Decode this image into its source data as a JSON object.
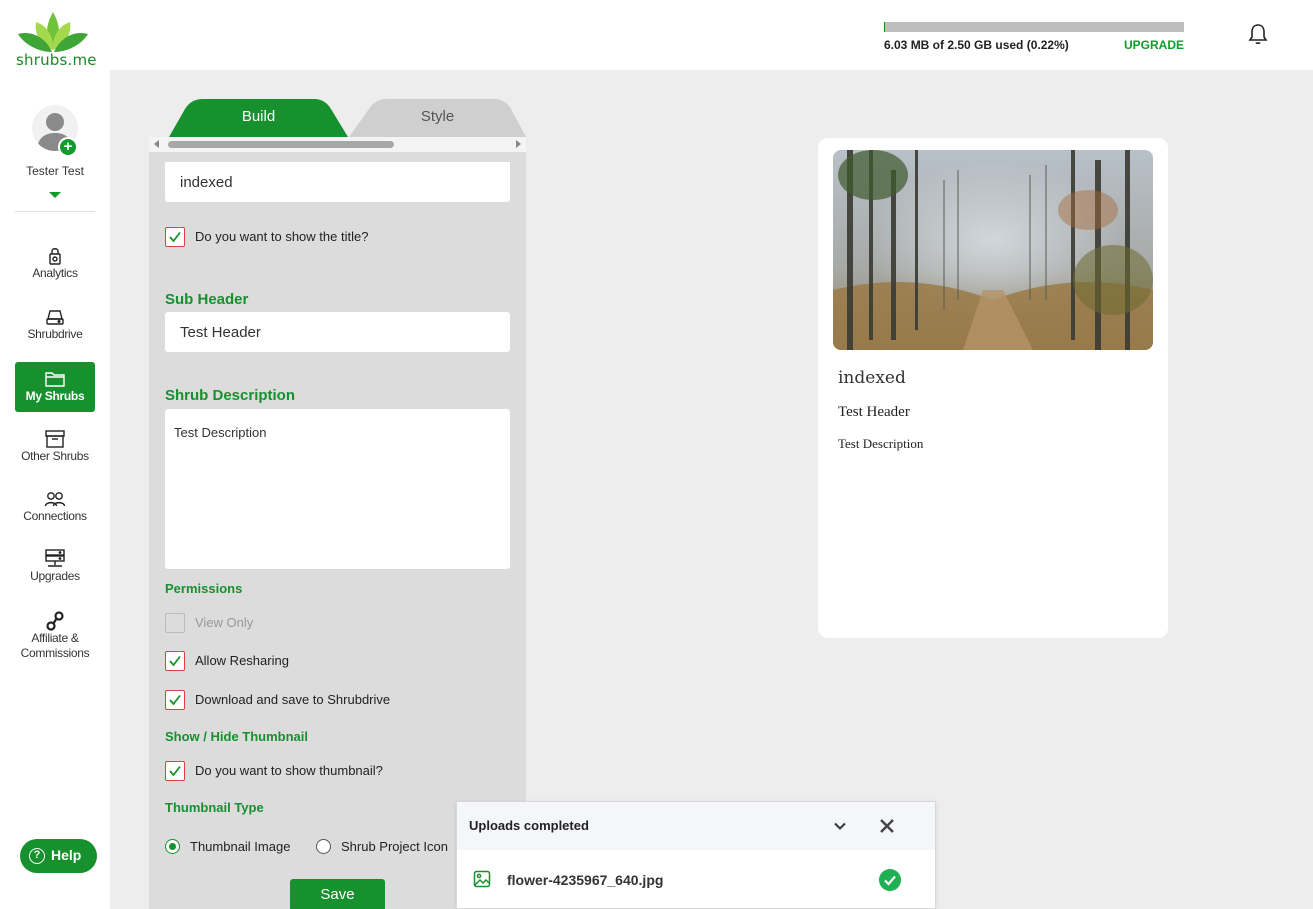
{
  "brand": {
    "name": "shrubs.me"
  },
  "storage": {
    "used_text": "6.03 MB of 2.50 GB used (0.22%)",
    "used_fraction": 0.0022,
    "upgrade_label": "UPGRADE"
  },
  "user": {
    "name": "Tester Test"
  },
  "sidebar": {
    "items": [
      {
        "label": "Analytics",
        "icon": "analytics-lock-icon"
      },
      {
        "label": "Shrubdrive",
        "icon": "drive-icon"
      },
      {
        "label": "My Shrubs",
        "icon": "folder-icon",
        "active": true
      },
      {
        "label": "Other Shrubs",
        "icon": "archive-box-icon"
      },
      {
        "label": "Connections",
        "icon": "people-icon"
      },
      {
        "label": "Upgrades",
        "icon": "server-icon"
      },
      {
        "label": "Affiliate &",
        "label2": "Commissions",
        "icon": "link-icon"
      }
    ],
    "help_label": "Help"
  },
  "editor": {
    "tabs": [
      {
        "label": "Build",
        "active": true
      },
      {
        "label": "Style",
        "active": false
      }
    ],
    "title_value": "indexed",
    "show_title_label": "Do you want to show the title?",
    "show_title_checked": true,
    "sub_header_label": "Sub Header",
    "sub_header_value": "Test Header",
    "description_label": "Shrub Description",
    "description_value": "Test Description",
    "permissions_label": "Permissions",
    "permissions": [
      {
        "label": "View Only",
        "checked": false
      },
      {
        "label": "Allow Resharing",
        "checked": true
      },
      {
        "label": "Download and save to Shrubdrive",
        "checked": true
      }
    ],
    "thumbnail_section_label": "Show / Hide Thumbnail",
    "show_thumbnail_label": "Do you want to show thumbnail?",
    "show_thumbnail_checked": true,
    "thumbnail_type_label": "Thumbnail Type",
    "thumbnail_types": [
      {
        "label": "Thumbnail Image",
        "selected": true
      },
      {
        "label": "Shrub Project Icon",
        "selected": false
      }
    ],
    "save_label": "Save"
  },
  "preview": {
    "title": "indexed",
    "sub_header": "Test Header",
    "description": "Test Description"
  },
  "uploads": {
    "title": "Uploads completed",
    "files": [
      {
        "name": "flower-4235967_640.jpg",
        "status": "completed"
      }
    ]
  },
  "colors": {
    "brand_green": "#17902e",
    "checkbox_border": "#e04040",
    "tab_inactive": "#cfcfcf"
  }
}
